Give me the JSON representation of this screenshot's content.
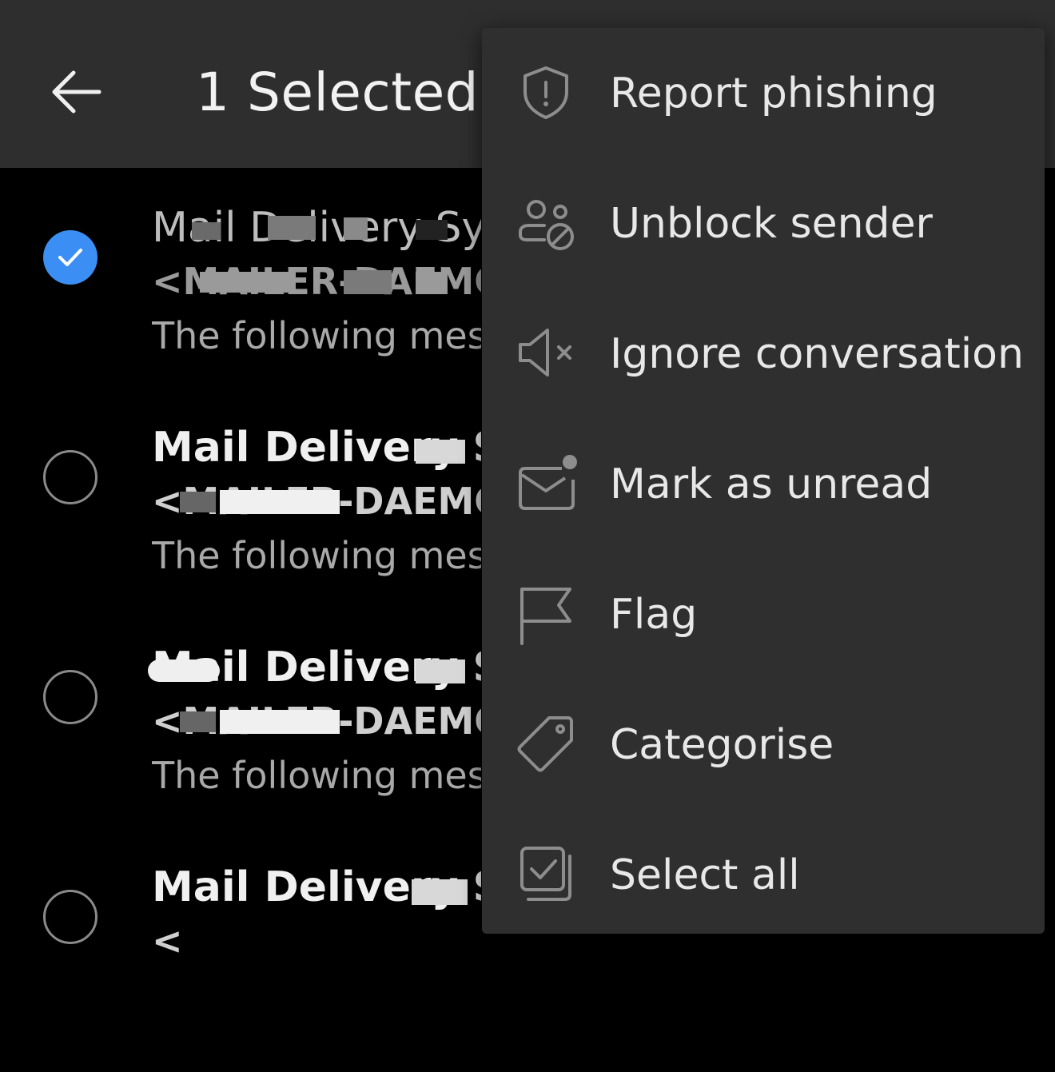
{
  "header": {
    "title": "1 Selected",
    "back_icon": "arrow-left-icon"
  },
  "messages": [
    {
      "selected": true,
      "sender": "Mail Delivery Sys",
      "address": "<MAILER-DAEMON",
      "preview": "The following mess",
      "unread": false
    },
    {
      "selected": false,
      "sender": "Mail Delivery Sys",
      "address": "<MAILER-DAEMON",
      "preview": "The following mess",
      "unread": true
    },
    {
      "selected": false,
      "sender": "Mail Delivery Sys",
      "address": "<MAILER-DAEMON",
      "preview": "The following mess",
      "unread": true
    },
    {
      "selected": false,
      "sender": "Mail Delivery Sys",
      "address": "<",
      "preview": "",
      "unread": true
    }
  ],
  "menu": {
    "items": [
      {
        "label": "Report phishing",
        "icon": "shield-alert-icon"
      },
      {
        "label": "Unblock sender",
        "icon": "unblock-person-icon"
      },
      {
        "label": "Ignore conversation",
        "icon": "mute-icon"
      },
      {
        "label": "Mark as unread",
        "icon": "mail-unread-icon"
      },
      {
        "label": "Flag",
        "icon": "flag-icon"
      },
      {
        "label": "Categorise",
        "icon": "tag-icon"
      },
      {
        "label": "Select all",
        "icon": "select-all-icon"
      }
    ]
  },
  "colors": {
    "accent": "#3b8ef3",
    "header_bg": "#2e2e2e",
    "menu_bg": "#2f2f2f"
  }
}
